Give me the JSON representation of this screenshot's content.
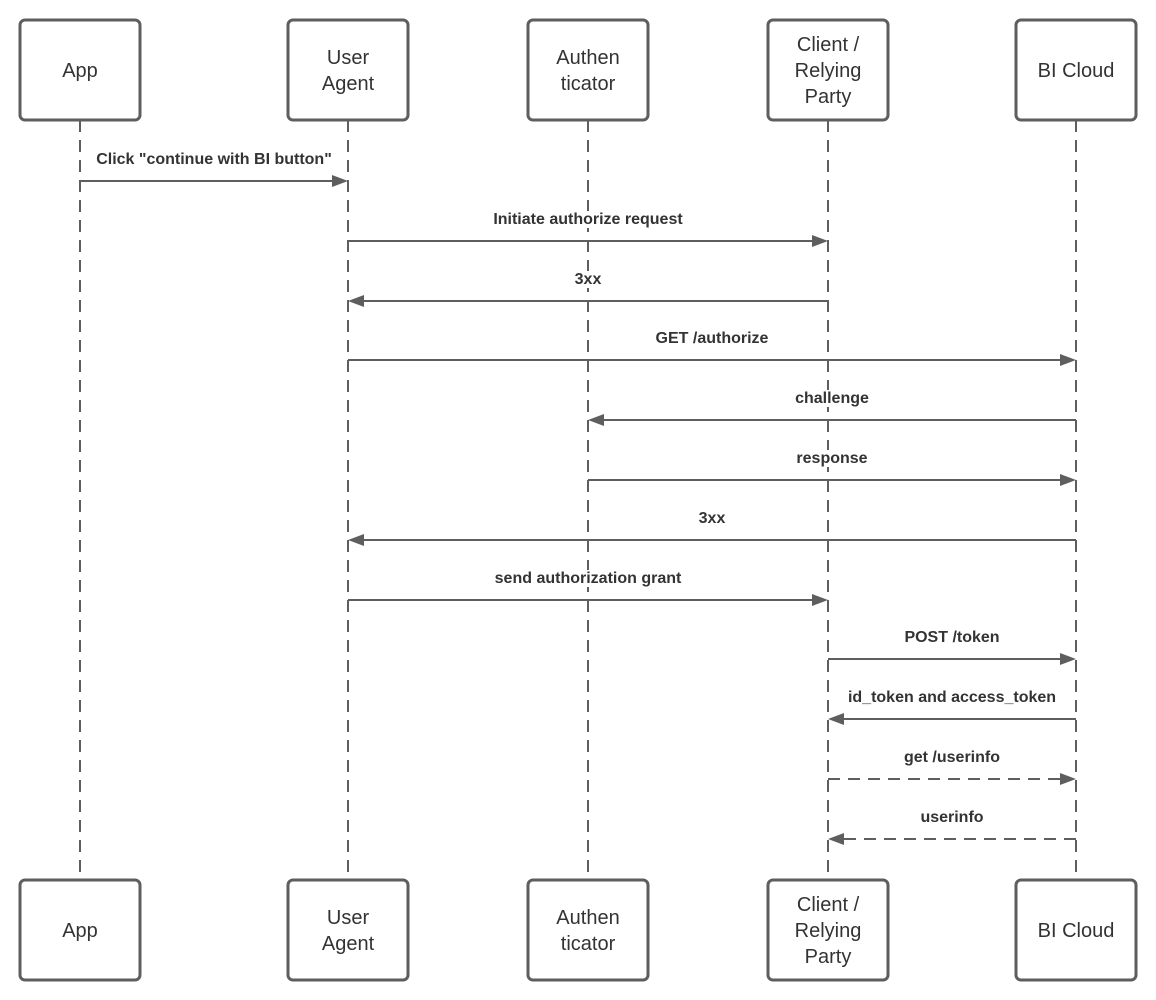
{
  "diagram": {
    "type": "sequence",
    "actors": [
      {
        "id": "app",
        "label_lines": [
          "App"
        ]
      },
      {
        "id": "user-agent",
        "label_lines": [
          "User",
          "Agent"
        ]
      },
      {
        "id": "authenticator",
        "label_lines": [
          "Authen",
          "ticator"
        ]
      },
      {
        "id": "client",
        "label_lines": [
          "Client /",
          "Relying",
          "Party"
        ]
      },
      {
        "id": "bi-cloud",
        "label_lines": [
          "BI Cloud"
        ]
      }
    ],
    "messages": [
      {
        "from": "app",
        "to": "user-agent",
        "label": "Click \"continue with BI button\"",
        "style": "solid"
      },
      {
        "from": "user-agent",
        "to": "client",
        "label": "Initiate authorize request",
        "style": "solid"
      },
      {
        "from": "client",
        "to": "user-agent",
        "label": "3xx",
        "style": "solid"
      },
      {
        "from": "user-agent",
        "to": "bi-cloud",
        "label": "GET /authorize",
        "style": "solid"
      },
      {
        "from": "bi-cloud",
        "to": "authenticator",
        "label": "challenge",
        "style": "solid"
      },
      {
        "from": "authenticator",
        "to": "bi-cloud",
        "label": "response",
        "style": "solid"
      },
      {
        "from": "bi-cloud",
        "to": "user-agent",
        "label": "3xx",
        "style": "solid"
      },
      {
        "from": "user-agent",
        "to": "client",
        "label": "send authorization grant",
        "style": "solid"
      },
      {
        "from": "client",
        "to": "bi-cloud",
        "label": "POST /token",
        "style": "solid"
      },
      {
        "from": "bi-cloud",
        "to": "client",
        "label": "id_token and access_token",
        "style": "solid"
      },
      {
        "from": "client",
        "to": "bi-cloud",
        "label": "get /userinfo",
        "style": "dashed"
      },
      {
        "from": "bi-cloud",
        "to": "client",
        "label": "userinfo",
        "style": "dashed"
      }
    ],
    "colors": {
      "stroke": "#5e5e5e",
      "text": "#333333",
      "background": "#ffffff"
    }
  }
}
